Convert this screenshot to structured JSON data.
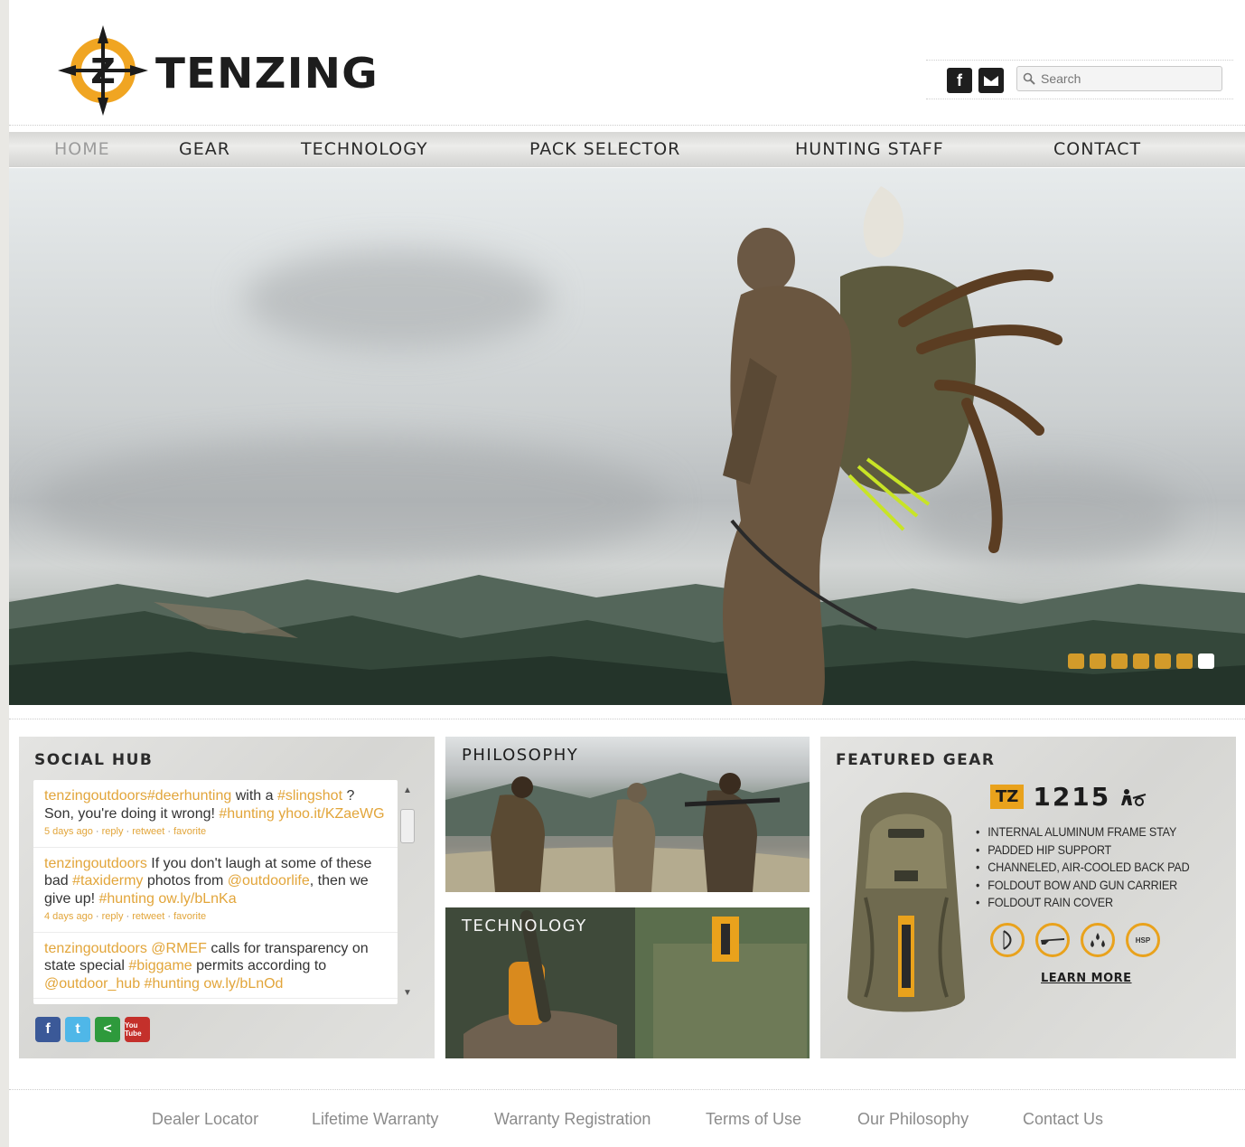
{
  "brand": {
    "name": "TENZING"
  },
  "header": {
    "social": [
      {
        "label": "f",
        "icon": "facebook-icon"
      },
      {
        "label": "twitter",
        "icon": "twitter-icon"
      }
    ],
    "search": {
      "placeholder": "Search"
    }
  },
  "nav": {
    "items": [
      {
        "label": "HOME",
        "active": true
      },
      {
        "label": "GEAR"
      },
      {
        "label": "TECHNOLOGY"
      },
      {
        "label": "PACK SELECTOR"
      },
      {
        "label": "HUNTING STAFF"
      },
      {
        "label": "CONTACT"
      }
    ]
  },
  "hero": {
    "slides_total": 7,
    "active_slide_index": 6,
    "colors": {
      "dot": "#d39b2a",
      "dot_active": "#ffffff"
    }
  },
  "social_hub": {
    "title": "SOCIAL HUB",
    "tweets": [
      {
        "user": "tenzingoutdoors",
        "segments": [
          {
            "t": "#deerhunting",
            "link": true
          },
          {
            "t": " with a ",
            "link": false
          },
          {
            "t": "#slingshot",
            "link": true
          },
          {
            "t": " ? Son, you're doing it wrong! ",
            "link": false
          },
          {
            "t": "#hunting",
            "link": true
          },
          {
            "t": " yhoo.it/KZaeWG",
            "link": true
          }
        ],
        "time": "5 days ago"
      },
      {
        "user": "tenzingoutdoors",
        "segments": [
          {
            "t": " If you don't laugh at some of these bad ",
            "link": false
          },
          {
            "t": "#taxidermy",
            "link": true
          },
          {
            "t": " photos from ",
            "link": false
          },
          {
            "t": "@outdoorlife",
            "link": true
          },
          {
            "t": ", then we give up! ",
            "link": false
          },
          {
            "t": "#hunting",
            "link": true
          },
          {
            "t": " ow.ly/bLnKa",
            "link": true
          }
        ],
        "time": "4 days ago"
      },
      {
        "user": "tenzingoutdoors",
        "segments": [
          {
            "t": " @RMEF",
            "link": true
          },
          {
            "t": " calls for transparency on state special ",
            "link": false
          },
          {
            "t": "#biggame",
            "link": true
          },
          {
            "t": " permits according to ",
            "link": false
          },
          {
            "t": "@outdoor_hub",
            "link": true
          },
          {
            "t": " #hunting",
            "link": true
          },
          {
            "t": " ow.ly/bLnOd",
            "link": true
          }
        ],
        "time": ""
      }
    ],
    "actions": {
      "reply": "reply",
      "retweet": "retweet",
      "favorite": "favorite"
    },
    "icons": [
      {
        "label": "f",
        "icon": "facebook-icon",
        "color": "#3b5998"
      },
      {
        "label": "t",
        "icon": "twitter-icon",
        "color": "#4fb7e8"
      },
      {
        "label": "<",
        "icon": "share-icon",
        "color": "#2e9a3c"
      },
      {
        "label": "You Tube",
        "icon": "youtube-icon",
        "color": "#c4302b"
      }
    ]
  },
  "philosophy": {
    "title": "PHILOSOPHY"
  },
  "technology": {
    "title": "TECHNOLOGY"
  },
  "featured_gear": {
    "title": "FEATURED GEAR",
    "badge": "TZ",
    "model": "1215",
    "features": [
      "INTERNAL ALUMINUM FRAME STAY",
      "PADDED HIP SUPPORT",
      "CHANNELED, AIR-COOLED BACK PAD",
      "FOLDOUT BOW AND GUN CARRIER",
      "FOLDOUT RAIN COVER"
    ],
    "icons": [
      "bow-icon",
      "rifle-icon",
      "water-drops-icon",
      "hsp-icon"
    ],
    "hsp_label": "HSP",
    "cta": "LEARN MORE"
  },
  "footer": {
    "links": [
      "Dealer Locator",
      "Lifetime Warranty",
      "Warranty Registration",
      "Terms of Use",
      "Our Philosophy",
      "Contact Us"
    ]
  }
}
